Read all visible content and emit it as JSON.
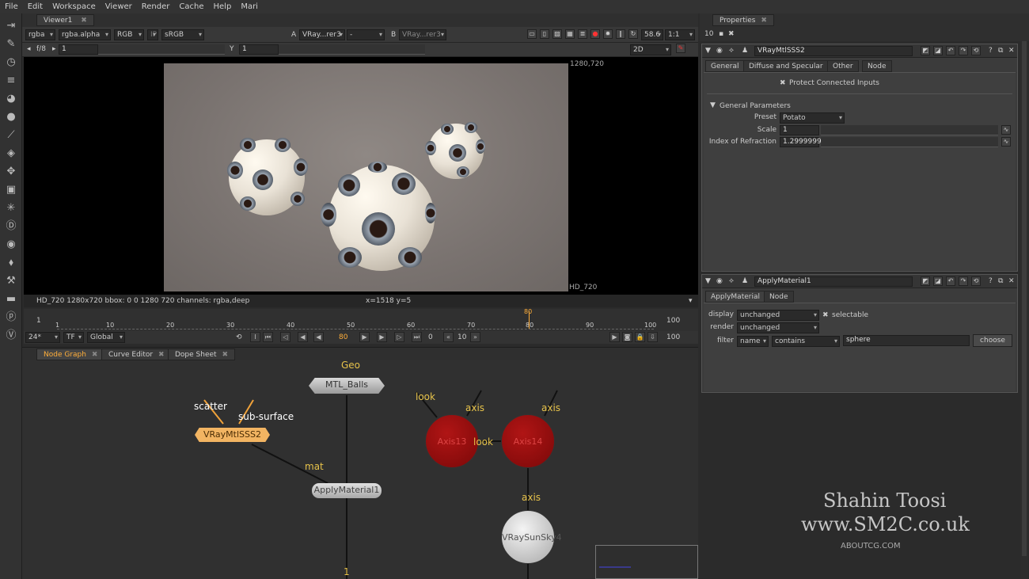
{
  "menu": [
    "File",
    "Edit",
    "Workspace",
    "Viewer",
    "Render",
    "Cache",
    "Help",
    "Mari"
  ],
  "viewer": {
    "tab": "Viewer1",
    "channels": "rgba",
    "alpha": "rgba.alpha",
    "colorspace_mode": "RGB",
    "ip": "IP",
    "lut": "sRGB",
    "input_a_label": "A",
    "input_a": "VRay...rer3",
    "dash": "-",
    "input_b_label": "B",
    "input_b": "VRay...rer3",
    "zoom": "58.6",
    "ratio": "1:1",
    "fstop": "f/8",
    "gain": "1",
    "gamma_label": "Y",
    "gamma": "1",
    "view_mode": "2D",
    "res_top": "1280,720",
    "format_label": "HD_720",
    "status_left": "HD_720 1280x720  bbox: 0 0 1280 720 channels: rgba,deep",
    "status_coords": "x=1518 y=5",
    "timeline": {
      "start": "1",
      "end": "100",
      "ticks": [
        "1",
        "10",
        "20",
        "30",
        "40",
        "50",
        "60",
        "70",
        "80",
        "90",
        "100"
      ],
      "current": "80"
    },
    "play": {
      "fps": "24*",
      "tf": "TF",
      "scope": "Global",
      "current_frame": "80",
      "step": "10",
      "end": "100",
      "zero": "0"
    }
  },
  "nodegraph": {
    "tabs": [
      "Node Graph",
      "Curve Editor",
      "Dope Sheet"
    ],
    "labels": {
      "geo": "Geo",
      "scatter": "scatter",
      "subsurface": "sub-surface",
      "mat": "mat",
      "look1": "look",
      "axis1": "axis",
      "axis2": "axis",
      "look2": "look",
      "axis3": "axis",
      "one": "1"
    },
    "nodes": {
      "mtl_balls": "MTL_Balls",
      "vraymtl": "VRayMtlSSS2",
      "applymaterial": "ApplyMaterial1",
      "axis13": "Axis13",
      "axis14": "Axis14",
      "vraysunsky": "VRaySunSky4"
    }
  },
  "properties": {
    "tab": "Properties",
    "count": "10",
    "panel1": {
      "name": "VRayMtlSSS2",
      "tabs": [
        "General",
        "Diffuse and Specular",
        "Other",
        "Node"
      ],
      "protect": "Protect Connected Inputs",
      "section": "General Parameters",
      "preset_label": "Preset",
      "preset": "Potato",
      "scale_label": "Scale",
      "scale": "1",
      "ior_label": "Index of Refraction",
      "ior": "1.2999999"
    },
    "panel2": {
      "name": "ApplyMaterial1",
      "tabs": [
        "ApplyMaterial",
        "Node"
      ],
      "display_label": "display",
      "display": "unchanged",
      "selectable": "selectable",
      "render_label": "render",
      "render": "unchanged",
      "filter_label": "filter",
      "filter_name": "name",
      "filter_op": "contains",
      "filter_value": "sphere",
      "choose": "choose"
    }
  },
  "watermark": {
    "line1": "Shahin Toosi",
    "line2": "www.SM2C.co.uk",
    "line3": "ABOUTCG.COM"
  },
  "colors": {
    "accent": "#ffae3a",
    "node_red": "#a00f0f",
    "label_yellow": "#e6c24a"
  }
}
